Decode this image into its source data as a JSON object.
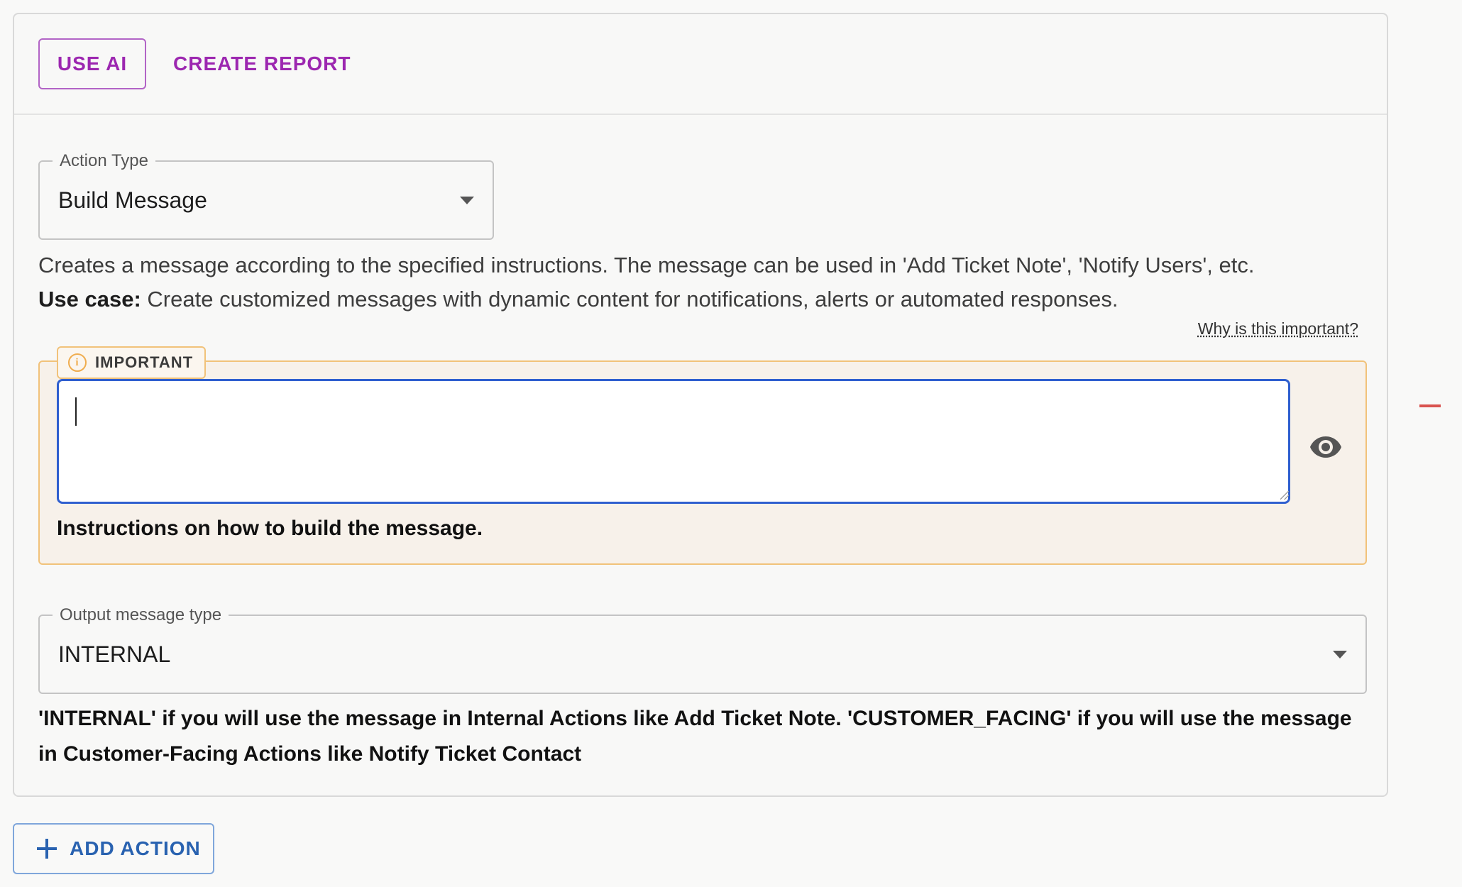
{
  "header": {
    "use_ai_label": "USE AI",
    "create_report_label": "CREATE REPORT"
  },
  "action_type": {
    "label": "Action Type",
    "value": "Build Message"
  },
  "description": {
    "text": "Creates a message according to the specified instructions. The message can be used in 'Add Ticket Note', 'Notify Users', etc.",
    "use_case_label": "Use case:",
    "use_case_text": "Create customized messages with dynamic content for notifications, alerts or automated responses."
  },
  "why_link": "Why is this important?",
  "important": {
    "tag_label": "IMPORTANT",
    "instructions_value": "",
    "helper": "Instructions on how to build the message."
  },
  "output_type": {
    "label": "Output message type",
    "value": "INTERNAL",
    "helper": "'INTERNAL' if you will use the message in Internal Actions like Add Ticket Note. 'CUSTOMER_FACING' if you will use the message in Customer-Facing Actions like Notify Ticket Contact"
  },
  "add_action_label": "ADD ACTION",
  "colors": {
    "accent_purple": "#9c27b0",
    "focus_blue": "#2f5fcf",
    "important_orange": "#f1c27a",
    "link_blue": "#2962b0"
  },
  "icons": [
    "info-icon",
    "eye-icon",
    "plus-icon",
    "chevron-down-icon"
  ]
}
